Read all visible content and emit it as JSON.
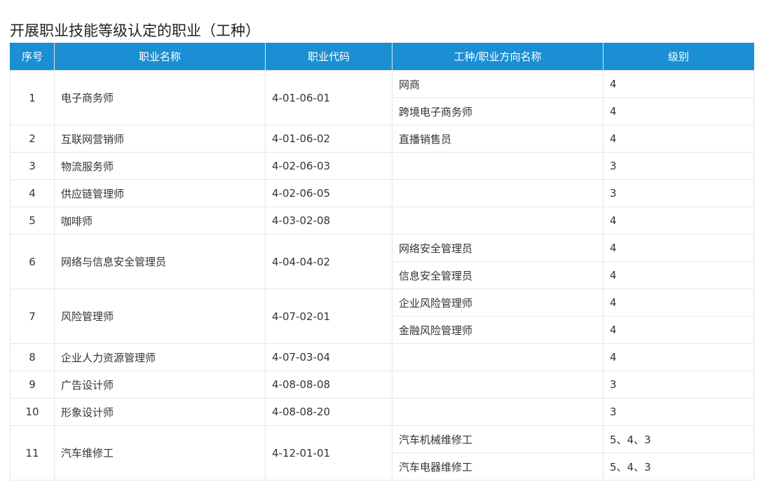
{
  "title": "开展职业技能等级认定的职业（工种）",
  "headers": {
    "no": "序号",
    "name": "职业名称",
    "code": "职业代码",
    "direction": "工种/职业方向名称",
    "level": "级别"
  },
  "rows": [
    {
      "no": "1",
      "name": "电子商务师",
      "code": "4-01-06-01",
      "subs": [
        {
          "direction": "网商",
          "level": "4"
        },
        {
          "direction": "跨境电子商务师",
          "level": "4"
        }
      ]
    },
    {
      "no": "2",
      "name": "互联网营销师",
      "code": "4-01-06-02",
      "subs": [
        {
          "direction": "直播销售员",
          "level": "4"
        }
      ]
    },
    {
      "no": "3",
      "name": "物流服务师",
      "code": "4-02-06-03",
      "subs": [
        {
          "direction": "",
          "level": "3"
        }
      ]
    },
    {
      "no": "4",
      "name": "供应链管理师",
      "code": "4-02-06-05",
      "subs": [
        {
          "direction": "",
          "level": "3"
        }
      ]
    },
    {
      "no": "5",
      "name": "咖啡师",
      "code": "4-03-02-08",
      "subs": [
        {
          "direction": "",
          "level": "4"
        }
      ]
    },
    {
      "no": "6",
      "name": "网络与信息安全管理员",
      "code": "4-04-04-02",
      "subs": [
        {
          "direction": "网络安全管理员",
          "level": "4"
        },
        {
          "direction": "信息安全管理员",
          "level": "4"
        }
      ]
    },
    {
      "no": "7",
      "name": "风险管理师",
      "code": "4-07-02-01",
      "subs": [
        {
          "direction": "企业风险管理师",
          "level": "4"
        },
        {
          "direction": "金融风险管理师",
          "level": "4"
        }
      ]
    },
    {
      "no": "8",
      "name": "企业人力资源管理师",
      "code": "4-07-03-04",
      "subs": [
        {
          "direction": "",
          "level": "4"
        }
      ]
    },
    {
      "no": "9",
      "name": "广告设计师",
      "code": "4-08-08-08",
      "subs": [
        {
          "direction": "",
          "level": "3"
        }
      ]
    },
    {
      "no": "10",
      "name": "形象设计师",
      "code": "4-08-08-20",
      "subs": [
        {
          "direction": "",
          "level": "3"
        }
      ]
    },
    {
      "no": "11",
      "name": "汽车维修工",
      "code": "4-12-01-01",
      "subs": [
        {
          "direction": "汽车机械维修工",
          "level": "5、4、3"
        },
        {
          "direction": "汽车电器维修工",
          "level": "5、4、3"
        }
      ]
    }
  ]
}
